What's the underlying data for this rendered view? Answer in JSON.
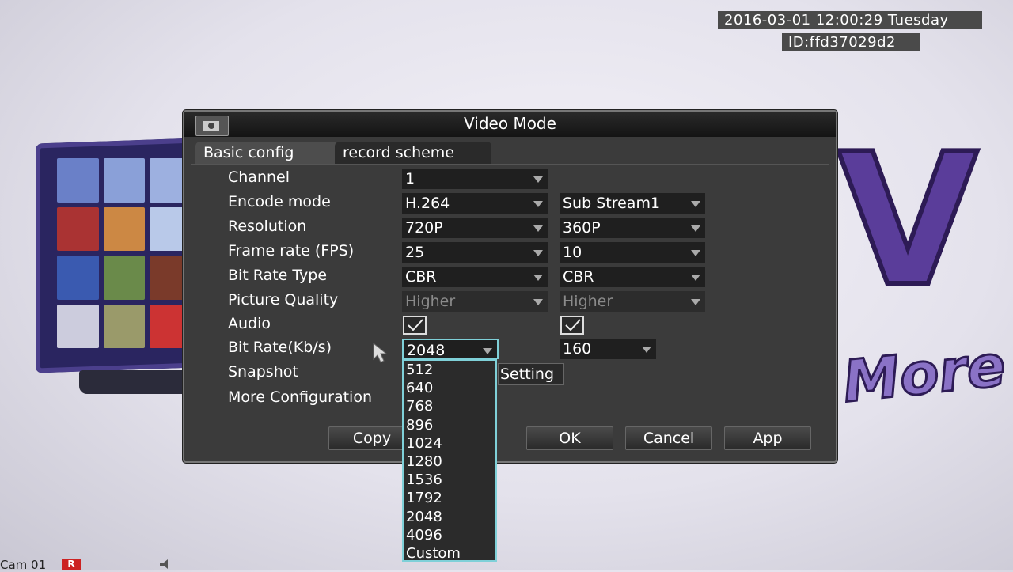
{
  "osd": {
    "datetime": "2016-03-01 12:00:29  Tuesday",
    "device_id": "ID:ffd37029d2",
    "camera_label": "Cam 01",
    "rec_badge": "R"
  },
  "dialog": {
    "title": "Video Mode",
    "tabs": [
      {
        "label": "Basic config",
        "active": true
      },
      {
        "label": "record scheme",
        "active": false
      }
    ],
    "labels": {
      "channel": "Channel",
      "encode_mode": "Encode mode",
      "resolution": "Resolution",
      "frame_rate": "Frame rate (FPS)",
      "bit_rate_type": "Bit Rate Type",
      "picture_quality": "Picture Quality",
      "audio": "Audio",
      "bit_rate": "Bit Rate(Kb/s)",
      "snapshot": "Snapshot",
      "more_configuration": "More Configuration"
    },
    "main_stream": {
      "channel": "1",
      "encode_mode": "H.264",
      "resolution": "720P",
      "frame_rate": "25",
      "bit_rate_type": "CBR",
      "picture_quality": "Higher",
      "audio_checked": true,
      "bit_rate": "2048"
    },
    "sub_stream": {
      "encode_mode": "Sub Stream1",
      "resolution": "360P",
      "frame_rate": "10",
      "bit_rate_type": "CBR",
      "picture_quality": "Higher",
      "audio_checked": true,
      "bit_rate": "160"
    },
    "snapshot_setting_label": "Setting",
    "buttons": {
      "copy": "Copy",
      "ok": "OK",
      "cancel": "Cancel",
      "apply": "App"
    },
    "bit_rate_options": [
      "512",
      "640",
      "768",
      "896",
      "1024",
      "1280",
      "1536",
      "1792",
      "2048",
      "4096",
      "Custom"
    ]
  },
  "background": {
    "logo_letters": "V",
    "logo_word": "More"
  },
  "colors": {
    "dropdown_highlight": "#7fd0d8",
    "dialog_bg": "#3b3b3b"
  }
}
